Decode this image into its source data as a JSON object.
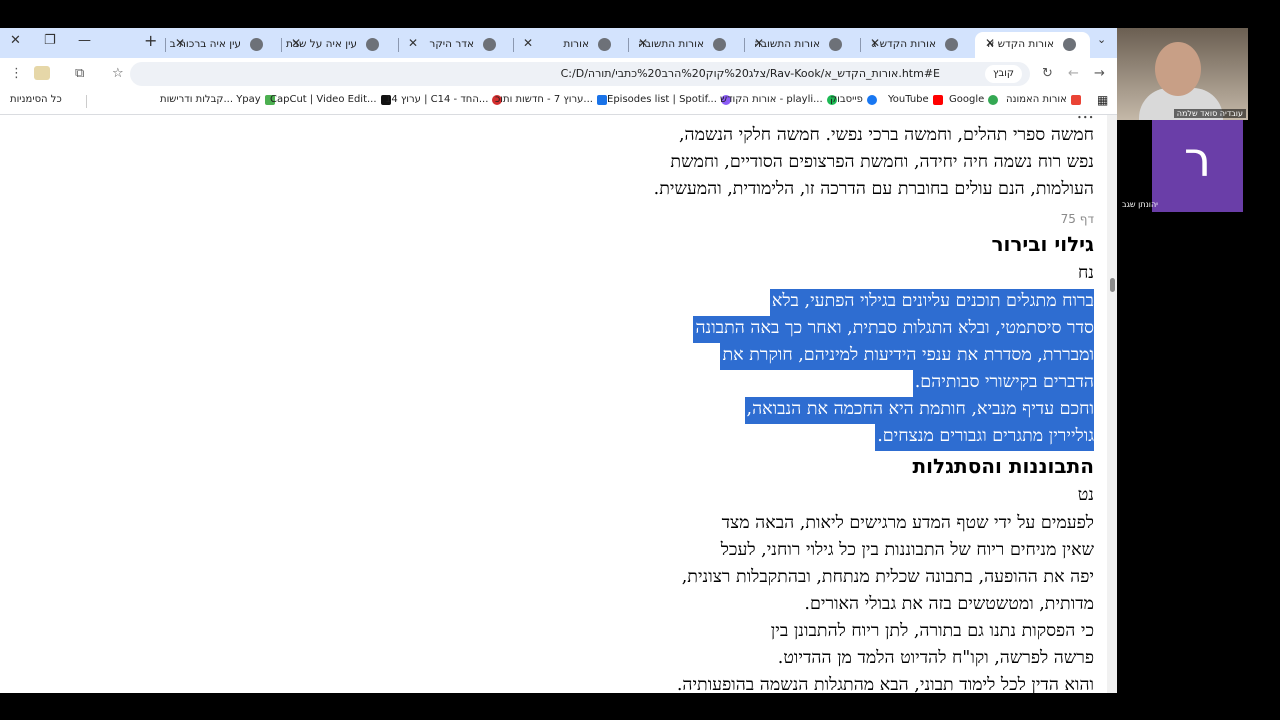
{
  "browser": {
    "tabs": [
      {
        "title": "אורות הקדש א",
        "active": true
      },
      {
        "title": "אורות הקדש ג"
      },
      {
        "title": "אורות התשובה"
      },
      {
        "title": "אורות התשובה"
      },
      {
        "title": "אורות"
      },
      {
        "title": "אדר היקר"
      },
      {
        "title": "עין איה על שבת"
      },
      {
        "title": "עין איה ברכות ב"
      }
    ],
    "new_tab": "+",
    "url": "C:/D/צלג%20קוק%20הרב%20כתבי/תורה/Rav-Kook/אורות_הקדש_א.htm#E",
    "omnibox_chip": "קובץ",
    "bookmarks": [
      {
        "label": "אורות האמונה",
        "color": "#1a73e8"
      },
      {
        "label": "Google",
        "color": "#34a853"
      },
      {
        "label": "YouTube",
        "color": "#ff0000"
      },
      {
        "label": "פייסבוק",
        "color": "#1877f2"
      },
      {
        "label": "אורות הקודש - playli...",
        "color": "#1db954"
      },
      {
        "label": "Episodes list | Spotif...",
        "color": "#8b5cf6"
      },
      {
        "label": "ערוץ 7 - חדשות ותוכ...",
        "color": "#1a73e8"
      },
      {
        "label": "ערוץ 14 | C14 - החד...",
        "color": "#d32f2f"
      },
      {
        "label": "CapCut | Video Edit...",
        "color": "#111111"
      },
      {
        "label": "קבלות ודרישות... Ypay",
        "color": "#4caf50"
      }
    ],
    "bookmarks_folder": "כל הסימניות"
  },
  "document": {
    "lines_top": [
      "חמשה ספרי תהלים, וחמשה ברכי נפשי. חמשה חלקי הנשמה,",
      "נפש רוח נשמה חיה יחידה, וחמשת הפרצופים הסודיים, וחמשת",
      "העולמות, הנם עולים בחוברת עם הדרכה זו, הלימודית, והמעשית."
    ],
    "page_marker": "דף 75",
    "section1_title": "גילוי ובירור",
    "section1_number": "נח",
    "section1_lines": [
      "ברוח מתגלים תוכנים עליונים בגילוי הפתעי, בלא",
      "סדר סיסתמטי, ובלא התגלות סבתית, ואחר כך באה התבונה",
      "ומבררת, מסדרת את ענפי הידיעות למיניהם, חוקרת את",
      "הדברים בקישורי סבותיהם.",
      "וחכם עדיף מנביא, חותמת היא החכמה את הנבואה,",
      "גוליירין מתגרים וגבורים מנצחים."
    ],
    "section2_title": "התבוננות והסתגלות",
    "section2_number": "נט",
    "section2_lines": [
      "לפעמים על ידי שטף המדע מרגישים ליאות, הבאה מצד",
      "שאין מניחים ריוח של התבוננות בין כל גילוי רוחני, לעכל",
      "יפה את ההופעה, בתבונה שכלית מנתחת, ובהתקבלות רצונית,",
      "מדותית, ומטשטשים בזה את גבולי האורים.",
      "כי הפסקות נתנו גם בתורה, לתן ריוח להתבונן בין",
      "פרשה לפרשה, וקו\"ח להדיוט הלמד מן ההדיוט.",
      "והוא הדין לכל לימוד תבוני, הבא מהתגלות הנשמה בהופעותיה."
    ]
  },
  "video": {
    "participant1_name": "עובדיה סואד שלמה",
    "participant2_initial": "ר",
    "participant2_name": "יהונתן שגב"
  },
  "colors": {
    "selection": "#2e6dd1",
    "tabstrip": "#d3e3fd",
    "avatar": "#6a3ea8"
  }
}
